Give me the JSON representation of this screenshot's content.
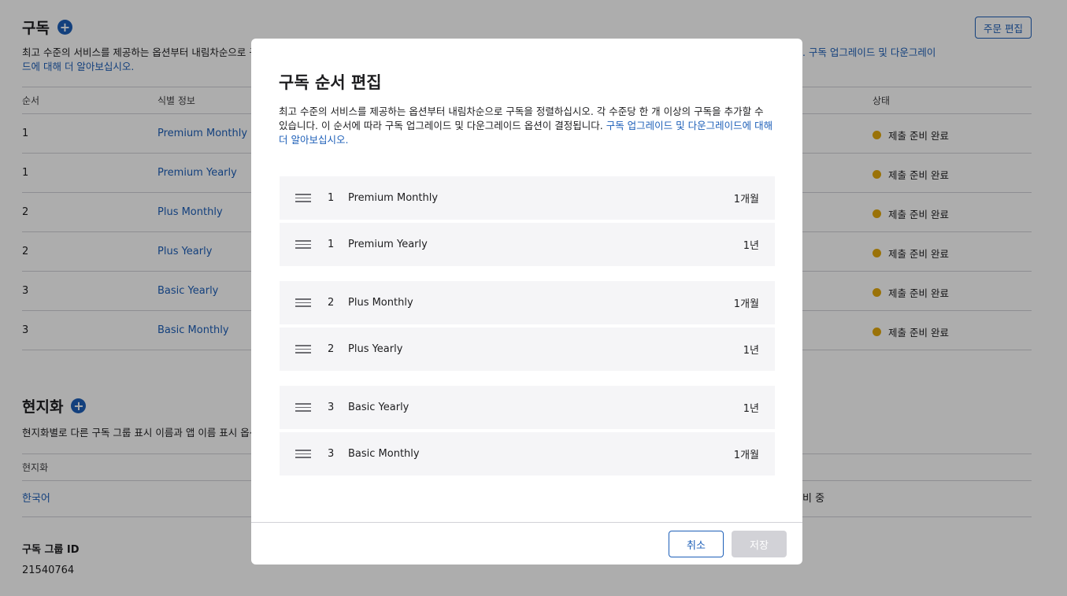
{
  "subscriptions_section": {
    "title": "구독",
    "add_label": "+",
    "desc_line1": "최고 수준의 서비스를 제공하는 옵션부터 내림차순으로 구",
    "desc_link_right": ". 구독 업그레이드 및 다운그레이",
    "desc_line2_link": "드에 대해 더 알아보십시오.",
    "edit_order_label": "주문 편집",
    "columns": {
      "order": "순서",
      "identifier": "식별 정보",
      "status": "상태"
    },
    "rows": [
      {
        "order": "1",
        "name": "Premium Monthly",
        "status": "제출 준비 완료"
      },
      {
        "order": "1",
        "name": "Premium Yearly",
        "status": "제출 준비 완료"
      },
      {
        "order": "2",
        "name": "Plus Monthly",
        "status": "제출 준비 완료"
      },
      {
        "order": "2",
        "name": "Plus Yearly",
        "status": "제출 준비 완료"
      },
      {
        "order": "3",
        "name": "Basic Yearly",
        "status": "제출 준비 완료"
      },
      {
        "order": "3",
        "name": "Basic Monthly",
        "status": "제출 준비 완료"
      }
    ]
  },
  "localization_section": {
    "title": "현지화",
    "add_label": "+",
    "desc": "현지화별로 다른 구독 그룹 표시 이름과 앱 이름 표시 옵션",
    "column": "현지화",
    "row_lang": "한국어",
    "row_status_partial": "비 중"
  },
  "group_id": {
    "label": "구독 그룹 ID",
    "value": "21540764"
  },
  "modal": {
    "title": "구독 순서 편집",
    "desc_text": "최고 수준의 서비스를 제공하는 옵션부터 내림차순으로 구독을 정렬하십시오. 각 수준당 한 개 이상의 구독을 추가할 수 있습니다. 이 순서에 따라 구독 업그레이드 및 다운그레이드 옵션이 결정됩니다. ",
    "desc_link": "구독 업그레이드 및 다운그레이드에 대해 더 알아보십시오.",
    "items": [
      {
        "level": "1",
        "name": "Premium Monthly",
        "duration": "1개월"
      },
      {
        "level": "1",
        "name": "Premium Yearly",
        "duration": "1년"
      },
      {
        "level": "2",
        "name": "Plus Monthly",
        "duration": "1개월"
      },
      {
        "level": "2",
        "name": "Plus Yearly",
        "duration": "1년"
      },
      {
        "level": "3",
        "name": "Basic Yearly",
        "duration": "1년"
      },
      {
        "level": "3",
        "name": "Basic Monthly",
        "duration": "1개월"
      }
    ],
    "cancel_label": "취소",
    "save_label": "저장"
  },
  "colors": {
    "accent": "#1d5fb8",
    "status_dot": "#e3a90c",
    "row_bg": "#f5f5f7",
    "disabled": "#d2d2d7"
  }
}
